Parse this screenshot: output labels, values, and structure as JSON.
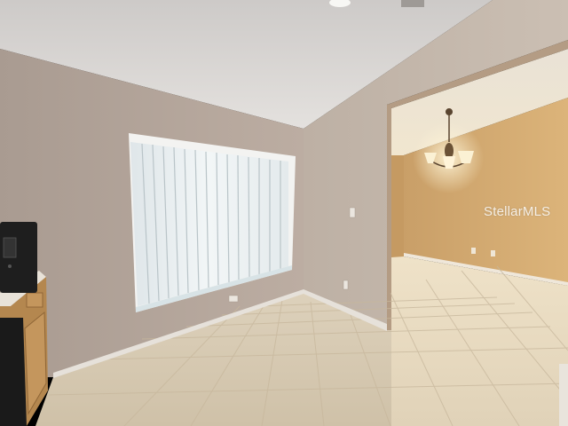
{
  "watermark": {
    "text": "StellarMLS"
  },
  "colors": {
    "ceiling": "#d9d6d3",
    "left_wall": "#b8aaa0",
    "center_wall": "#bfb0a5",
    "right_wall": "#c6b9ac",
    "dining_wall": "#d7ae72",
    "floor_tile": "#e3d9c5",
    "baseboard": "#e8e4de",
    "blinds": "#e9eef0",
    "cabinet": "#b98c56",
    "appliance": "#1e1e1e"
  }
}
